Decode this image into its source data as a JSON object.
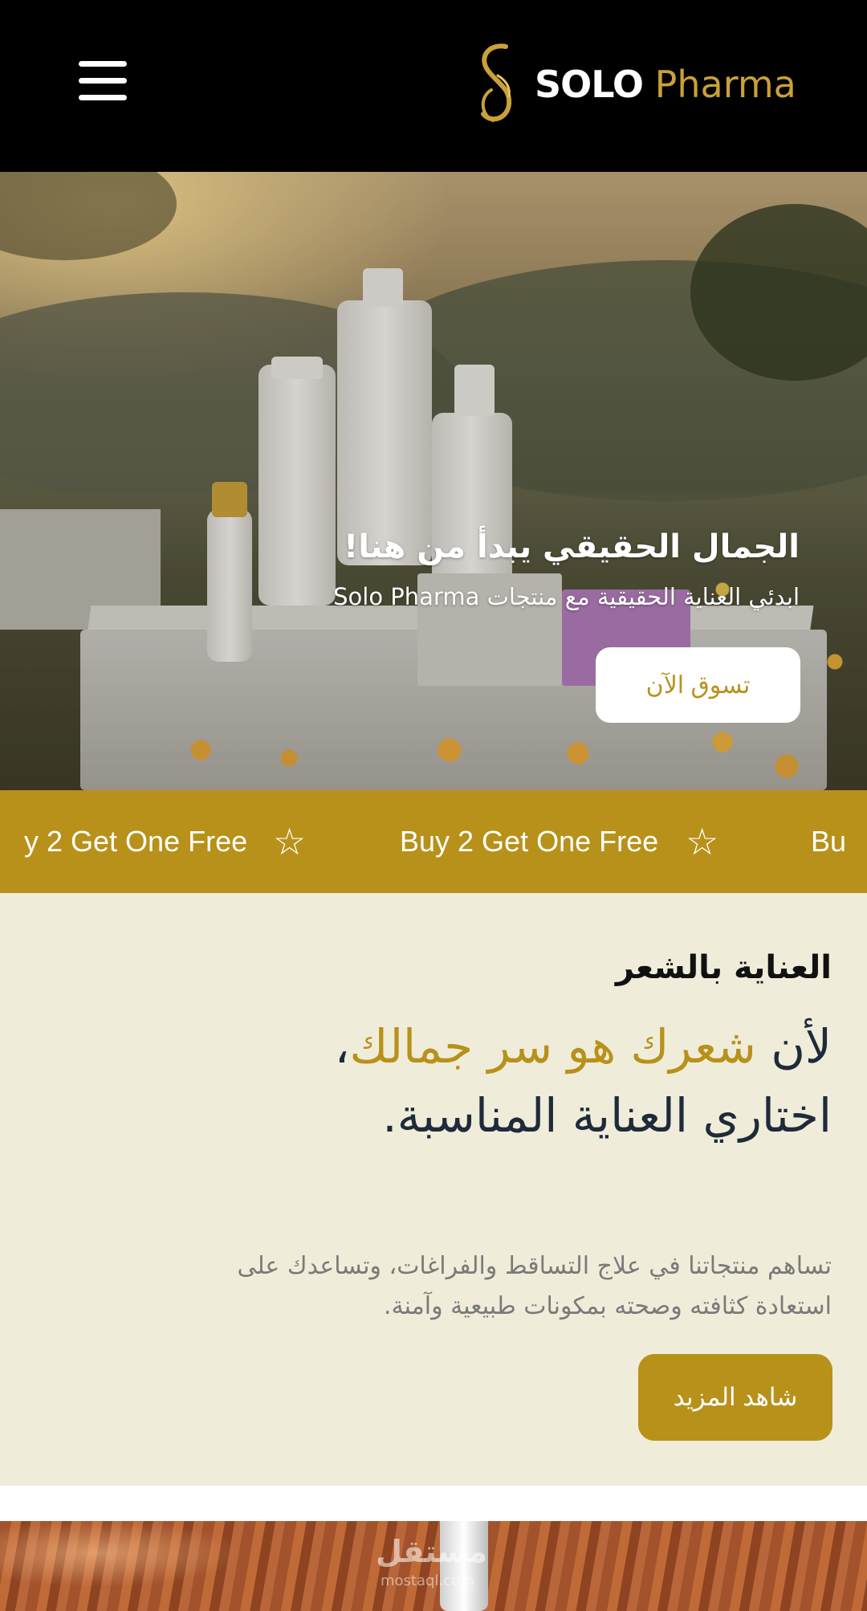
{
  "header": {
    "menu_icon": "hamburger-menu-icon",
    "logo_icon": "solo-s-logo-icon",
    "brand_primary": "SOLO",
    "brand_secondary": "Pharma"
  },
  "hero": {
    "title": "الجمال الحقيقي يبدأ من هنا!",
    "subtitle": "ابدئي العناية الحقيقية مع منتجات Solo Pharma",
    "cta_label": "تسوق الآن"
  },
  "promo": {
    "items": [
      "y 2 Get One Free",
      "Buy 2 Get One Free",
      "Bu"
    ],
    "separator_icon": "star-outline-icon"
  },
  "hair_care": {
    "kicker": "العناية بالشعر",
    "headline_part1": "لأن ",
    "headline_gold1": "شعرك هو سر جمالك",
    "headline_part2": "، اختاري العناية المناسبة.",
    "description": "تساهم منتجاتنا في علاج التساقط والفراغات، وتساعدك على استعادة كثافته وصحته بمكونات طبيعية وآمنة.",
    "cta_label": "شاهد المزيد"
  },
  "watermark": {
    "text": "مستقل",
    "sub": "mostaql.com"
  },
  "colors": {
    "header_bg": "#000000",
    "accent_gold": "#b8911a",
    "section_bg": "#efedda",
    "headline_navy": "#1f2a3a"
  }
}
